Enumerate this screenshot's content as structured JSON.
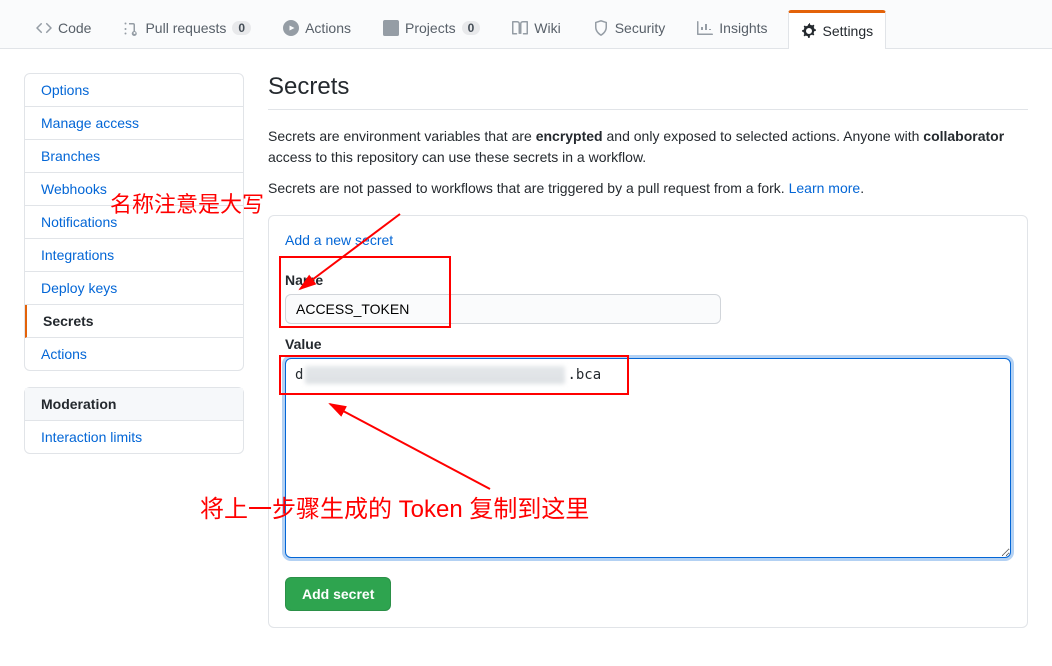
{
  "nav": {
    "code": "Code",
    "pull_requests": "Pull requests",
    "pull_requests_count": "0",
    "actions": "Actions",
    "projects": "Projects",
    "projects_count": "0",
    "wiki": "Wiki",
    "security": "Security",
    "insights": "Insights",
    "settings": "Settings"
  },
  "sidebar": {
    "items": [
      "Options",
      "Manage access",
      "Branches",
      "Webhooks",
      "Notifications",
      "Integrations",
      "Deploy keys",
      "Secrets",
      "Actions"
    ],
    "moderation_heading": "Moderation",
    "moderation_items": [
      "Interaction limits"
    ]
  },
  "page": {
    "title": "Secrets",
    "desc1_a": "Secrets are environment variables that are ",
    "desc1_b": "encrypted",
    "desc1_c": " and only exposed to selected actions. Anyone with ",
    "desc1_d": "collaborator",
    "desc1_e": " access to this repository can use these secrets in a workflow.",
    "desc2_a": "Secrets are not passed to workflows that are triggered by a pull request from a fork. ",
    "desc2_link": "Learn more",
    "desc2_b": ".",
    "add_secret_link": "Add a new secret",
    "name_label": "Name",
    "name_value": "ACCESS_TOKEN",
    "value_label": "Value",
    "token_prefix": "d",
    "token_suffix": ".bca",
    "submit": "Add secret"
  },
  "annotations": {
    "note1": "名称注意是大写",
    "note2": "将上一步骤生成的 Token 复制到这里"
  }
}
